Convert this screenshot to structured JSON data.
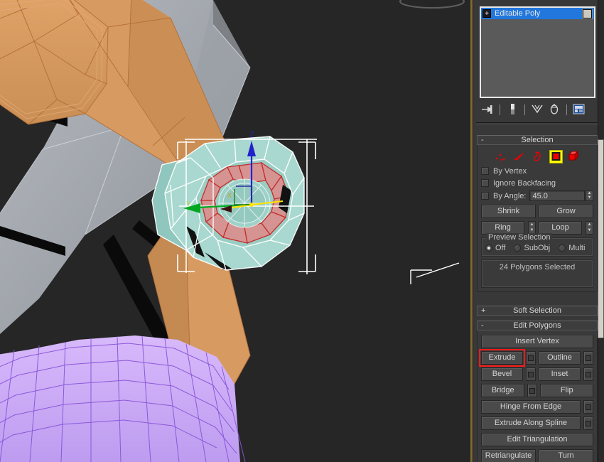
{
  "app": {
    "name": "3ds Max",
    "viewport_background": "#262626",
    "panel_background": "#383838",
    "accent_highlight": "#ff1a1a",
    "active_mode_color": "#ffff00"
  },
  "viewport": {
    "label": "perspective-viewport",
    "selected_object_name": "Editable Poly",
    "objects": [
      {
        "name": "orange-arm-mesh",
        "color": "#d79a61"
      },
      {
        "name": "gray-body-mesh",
        "color": "#a6aab0"
      },
      {
        "name": "teal-hub-mesh",
        "color": "#a8d8cf"
      },
      {
        "name": "purple-dome-mesh",
        "color": "#c9a6f0"
      },
      {
        "name": "selected-polygons",
        "color": "#e79a9a"
      }
    ],
    "gizmo": {
      "name": "move-gizmo",
      "axes": [
        "X",
        "Y",
        "Z"
      ],
      "x_color": "#ff0000",
      "y_color": "#00cc00",
      "z_color": "#2222dd",
      "active_axis_color": "#ffff00"
    },
    "selection_brackets": true
  },
  "command_panel": {
    "modifier_stack": {
      "items": [
        {
          "label": "Editable Poly",
          "expander": "+",
          "selected": true
        }
      ],
      "toolbar": [
        {
          "icon": "pin-stack-icon",
          "tooltip": "Pin Stack"
        },
        {
          "icon": "show-end-result-icon",
          "tooltip": "Show End Result"
        },
        {
          "icon": "make-unique-icon",
          "tooltip": "Make Unique"
        },
        {
          "icon": "remove-modifier-icon",
          "tooltip": "Remove Modifier"
        },
        {
          "icon": "configure-modifier-sets-icon",
          "tooltip": "Configure Modifier Sets"
        }
      ]
    },
    "rollouts": [
      {
        "name": "selection",
        "title": "Selection",
        "sign": "-",
        "expanded": true,
        "subobject_modes": [
          {
            "name": "vertex-mode",
            "active": false
          },
          {
            "name": "edge-mode",
            "active": false
          },
          {
            "name": "border-mode",
            "active": false
          },
          {
            "name": "polygon-mode",
            "active": true
          },
          {
            "name": "element-mode",
            "active": false
          }
        ],
        "checkboxes": [
          {
            "label": "By Vertex",
            "checked": false
          },
          {
            "label": "Ignore Backfacing",
            "checked": false
          }
        ],
        "by_angle": {
          "label": "By Angle:",
          "checked": false,
          "value": "45.0"
        },
        "buttons": [
          "Shrink",
          "Grow",
          "Ring",
          "Loop"
        ],
        "preview_selection": {
          "title": "Preview Selection",
          "options": [
            {
              "label": "Off",
              "selected": true
            },
            {
              "label": "SubObj",
              "selected": false
            },
            {
              "label": "Multi",
              "selected": false
            }
          ]
        },
        "status": "24 Polygons Selected"
      },
      {
        "name": "soft-selection",
        "title": "Soft Selection",
        "sign": "+",
        "expanded": false
      },
      {
        "name": "edit-polygons",
        "title": "Edit Polygons",
        "sign": "-",
        "expanded": true,
        "buttons": [
          {
            "label": "Insert Vertex",
            "settings": false,
            "full": true,
            "highlighted": false
          },
          {
            "label": "Extrude",
            "settings": true,
            "full": false,
            "highlighted": true
          },
          {
            "label": "Outline",
            "settings": true,
            "full": false,
            "highlighted": false
          },
          {
            "label": "Bevel",
            "settings": true,
            "full": false,
            "highlighted": false
          },
          {
            "label": "Inset",
            "settings": true,
            "full": false,
            "highlighted": false
          },
          {
            "label": "Bridge",
            "settings": true,
            "full": false,
            "highlighted": false
          },
          {
            "label": "Flip",
            "settings": false,
            "full": false,
            "highlighted": false
          },
          {
            "label": "Hinge From Edge",
            "settings": true,
            "full": true,
            "highlighted": false
          },
          {
            "label": "Extrude Along Spline",
            "settings": true,
            "full": true,
            "highlighted": false
          },
          {
            "label": "Edit Triangulation",
            "settings": false,
            "full": true,
            "highlighted": false
          },
          {
            "label": "Retriangulate",
            "settings": false,
            "full": false,
            "highlighted": false
          },
          {
            "label": "Turn",
            "settings": false,
            "full": false,
            "highlighted": false
          }
        ]
      }
    ]
  }
}
